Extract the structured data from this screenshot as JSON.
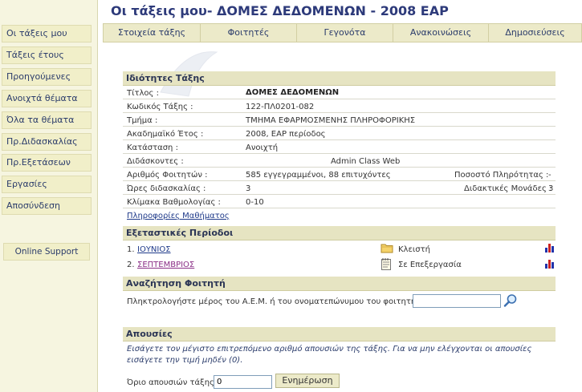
{
  "header": {
    "title": "Οι τάξεις μου- ΔΟΜΕΣ ΔΕΔΟΜΕΝΩΝ - 2008 ΕΑΡ"
  },
  "sidebar": {
    "items": [
      {
        "label": "Οι τάξεις μου"
      },
      {
        "label": "Τάξεις έτους"
      },
      {
        "label": "Προηγούμενες"
      },
      {
        "label": "Ανοιχτά θέματα"
      },
      {
        "label": "Όλα τα θέματα"
      },
      {
        "label": "Πρ.Διδασκαλίας"
      },
      {
        "label": "Πρ.Εξετάσεων"
      },
      {
        "label": "Εργασίες"
      },
      {
        "label": "Αποσύνδεση"
      }
    ],
    "support": "Online Support"
  },
  "tabs": [
    {
      "label": "Στοιχεία τάξης"
    },
    {
      "label": "Φοιτητές"
    },
    {
      "label": "Γεγονότα"
    },
    {
      "label": "Ανακοινώσεις"
    },
    {
      "label": "Δημοσιεύσεις"
    }
  ],
  "properties": {
    "heading": "Ιδιότητες Τάξης",
    "title_label": "Τίτλος :",
    "title_value": "ΔΟΜΕΣ ΔΕΔΟΜΕΝΩΝ",
    "code_label": "Κωδικός Τάξης :",
    "code_value": "122-ΠΛ0201-082",
    "dept_label": "Τμήμα :",
    "dept_value": "ΤΜΗΜΑ ΕΦΑΡΜΟΣΜΕΝΗΣ ΠΛΗΡΟΦΟΡΙΚΗΣ",
    "year_label": "Ακαδημαϊκό Έτος :",
    "year_value": "2008, ΕΑΡ περίοδος",
    "status_label": "Κατάσταση :",
    "status_value": "Ανοιχτή",
    "teachers_label": "Διδάσκοντες :",
    "teachers_value": "Admin Class Web",
    "students_label": "Αριθμός Φοιτητών :",
    "students_value": "585 εγγεγραμμένοι, 88 επιτυχόντες",
    "fill_label": "Ποσοστό Πληρότητας :",
    "fill_value": "-",
    "hours_label": "Ώρες διδασκαλίας :",
    "hours_value": "3",
    "units_label": "Διδακτικές Μονάδες :",
    "units_value": "3",
    "grade_label": "Κλίμακα Βαθμολογίας :",
    "grade_value": "0-10",
    "info_link": "Πληροφορίες Μαθήματος"
  },
  "exams": {
    "heading": "Εξεταστικές Περίοδοι",
    "periods": [
      {
        "num": "1.",
        "name": "ΙΟΥΝΙΟΣ",
        "status": "Κλειστή",
        "status_icon": "folder-icon"
      },
      {
        "num": "2.",
        "name": "ΣΕΠΤΕΜΒΡΙΟΣ",
        "status": "Σε Επεξεργασία",
        "status_icon": "notepad-icon"
      }
    ]
  },
  "search": {
    "heading": "Αναζήτηση Φοιτητή",
    "prompt": "Πληκτρολογήστε μέρος του Α.Ε.Μ. ή του ονοματεπώνυμου του φοιτητή :",
    "value": ""
  },
  "absences": {
    "heading": "Απουσίες",
    "note": "Εισάγετε τον μέγιστο επιτρεπόμενο αριθμό απουσιών της τάξης. Για να μην ελέγχονται οι απουσίες εισάγετε την τιμή μηδέν (0).",
    "limit_label": "Όριο απουσιών τάξης:",
    "limit_value": "0",
    "update_button": "Ενημέρωση"
  },
  "colors": {
    "title": "#2d3a7a",
    "sidebar_bg": "#f6f5e0",
    "section_bg": "#e6e4c2",
    "link": "#1f3a8a"
  }
}
